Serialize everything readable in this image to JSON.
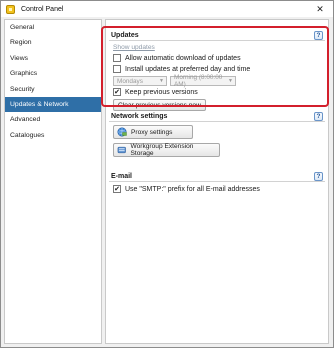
{
  "window": {
    "title": "Control Panel",
    "close_label": "✕"
  },
  "sidebar": {
    "items": [
      {
        "label": "General"
      },
      {
        "label": "Region"
      },
      {
        "label": "Views"
      },
      {
        "label": "Graphics"
      },
      {
        "label": "Security"
      },
      {
        "label": "Updates & Network",
        "active": true
      },
      {
        "label": "Advanced"
      },
      {
        "label": "Catalogues"
      }
    ]
  },
  "updates": {
    "title": "Updates",
    "help": "?",
    "show_updates_link": "Show updates",
    "allow_auto_download": {
      "label": "Allow automatic download of updates",
      "checked": false
    },
    "install_preferred": {
      "label": "Install updates at preferred day and time",
      "checked": false
    },
    "day_select": {
      "value": "Mondays"
    },
    "time_select": {
      "value": "Morning (8:00:00 AM)"
    },
    "keep_previous": {
      "label": "Keep previous versions",
      "checked": true,
      "mark": "✔"
    },
    "clear_button": "Clear previous versions now"
  },
  "network": {
    "title": "Network settings",
    "help": "?",
    "proxy_button": "Proxy settings",
    "workgroup_button": "Workgroup Extension Storage"
  },
  "email": {
    "title": "E-mail",
    "help": "?",
    "smtp_prefix": {
      "label": "Use \"SMTP:\" prefix for all E-mail addresses",
      "checked": true,
      "mark": "✔"
    }
  },
  "colors": {
    "accent": "#2f6fa7",
    "highlight": "#d31f2c"
  }
}
